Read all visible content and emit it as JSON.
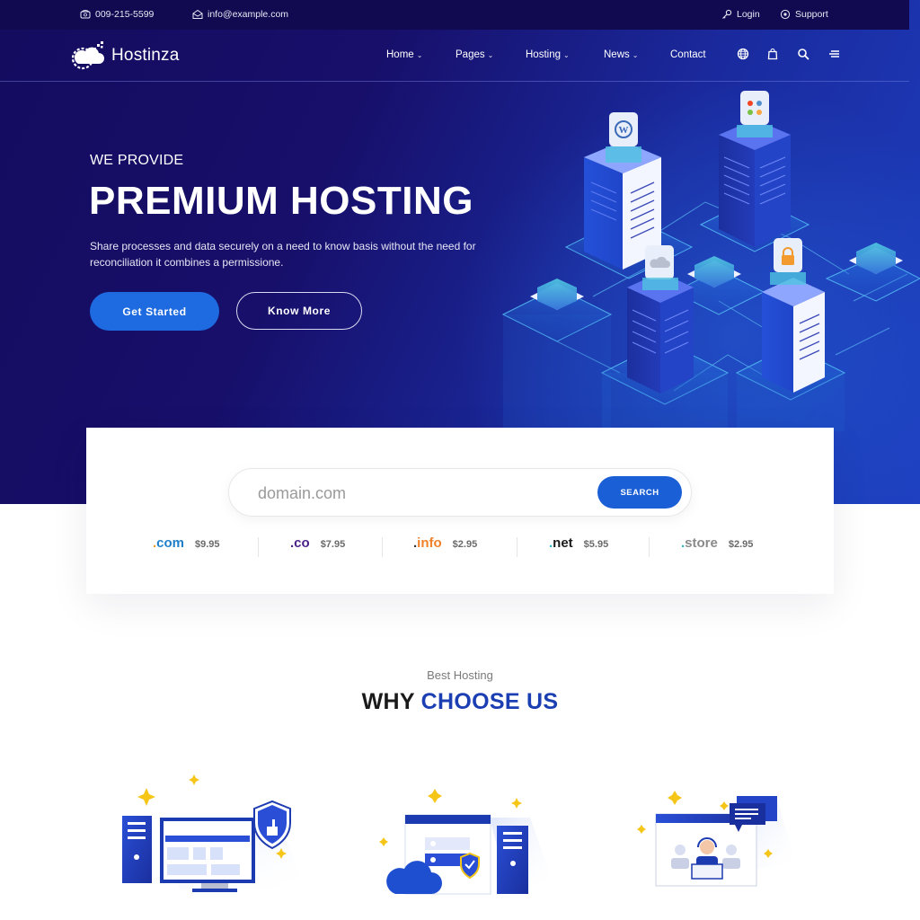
{
  "topbar": {
    "phone": "009-215-5599",
    "email": "info@example.com",
    "login_label": "Login",
    "support_label": "Support",
    "icons": {
      "phone": "phone-icon",
      "email": "envelope-icon",
      "login": "key-icon",
      "support": "support-icon"
    }
  },
  "nav": {
    "brand": "Hostinza",
    "items": [
      {
        "label": "Home",
        "has_dropdown": true
      },
      {
        "label": "Pages",
        "has_dropdown": true
      },
      {
        "label": "Hosting",
        "has_dropdown": true
      },
      {
        "label": "News",
        "has_dropdown": true
      },
      {
        "label": "Contact",
        "has_dropdown": false
      }
    ],
    "chevron": "⌄",
    "icons": [
      "globe-icon",
      "shopping-bag-icon",
      "search-icon",
      "menu-icon"
    ]
  },
  "hero": {
    "kicker": "WE PROVIDE",
    "headline": "PREMIUM HOSTING",
    "description": "Share processes and data securely on a need to know basis without the need for reconciliation it combines a permissione.",
    "primary_cta": "Get Started",
    "secondary_cta": "Know More",
    "illustration_badges": [
      "wordpress-icon",
      "joomla-icon",
      "cloud-icon",
      "lock-icon"
    ]
  },
  "domain_search": {
    "placeholder": "domain.com",
    "value": "",
    "button_label": "SEARCH",
    "tlds": [
      {
        "dot": ".",
        "name": "com",
        "price": "$9.95",
        "color": "#1f7fc8",
        "dot_color": "#f29a2e"
      },
      {
        "dot": ".",
        "name": "co",
        "price": "$7.95",
        "color": "#4a1f86",
        "dot_color": "#4a1f86"
      },
      {
        "dot": ".",
        "name": "info",
        "price": "$2.95",
        "color": "#f0812a",
        "dot_color": "#333333"
      },
      {
        "dot": ".",
        "name": "net",
        "price": "$5.95",
        "color": "#1a1a1a",
        "dot_color": "#2fb4c4"
      },
      {
        "dot": ".",
        "name": "store",
        "price": "$2.95",
        "color": "#8a8a8a",
        "dot_color": "#2fb4c4"
      }
    ]
  },
  "why_choose": {
    "kicker": "Best Hosting",
    "title_plain": "WHY",
    "title_accent": "CHOOSE US",
    "features": [
      {
        "icon": "secure-computer-icon"
      },
      {
        "icon": "cloud-server-icon"
      },
      {
        "icon": "support-team-icon"
      }
    ]
  },
  "colors": {
    "brand_dark": "#140c5e",
    "brand_blue": "#1e6ae0",
    "accent_title": "#1b3fb3"
  }
}
